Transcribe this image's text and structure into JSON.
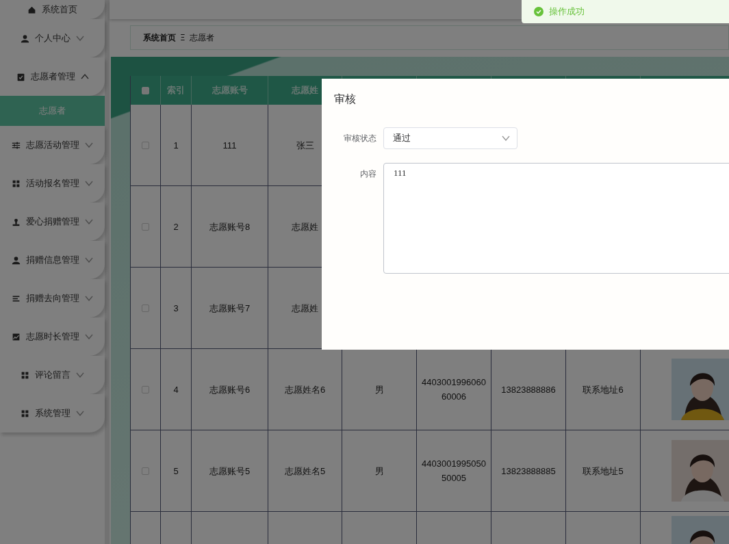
{
  "sidebar": {
    "items": [
      {
        "label": "系统首页"
      },
      {
        "label": "个人中心",
        "expanded": false
      },
      {
        "label": "志愿者管理",
        "expanded": true,
        "children": [
          {
            "label": "志愿者",
            "selected": true
          }
        ]
      },
      {
        "label": "志愿活动管理",
        "expanded": false
      },
      {
        "label": "活动报名管理",
        "expanded": false
      },
      {
        "label": "爱心捐赠管理",
        "expanded": false
      },
      {
        "label": "捐赠信息管理",
        "expanded": false
      },
      {
        "label": "捐赠去向管理",
        "expanded": false
      },
      {
        "label": "志愿时长管理",
        "expanded": false
      },
      {
        "label": "评论留言",
        "expanded": false
      },
      {
        "label": "系统管理",
        "expanded": false
      }
    ]
  },
  "breadcrumb": {
    "home": "系统首页",
    "separator": "Ξ",
    "current": "志愿者"
  },
  "table": {
    "select_all": {
      "checked": false
    },
    "columns": [
      {
        "label": "索引"
      },
      {
        "label": "志愿账号"
      },
      {
        "label": "志愿姓"
      }
    ],
    "rows": [
      {
        "checked": false,
        "cells": [
          "1",
          "111",
          "张三"
        ]
      },
      {
        "checked": false,
        "cells": [
          "2",
          "志愿账号8",
          "志愿姓"
        ]
      },
      {
        "checked": false,
        "cells": [
          "3",
          "志愿账号7",
          "志愿姓"
        ]
      },
      {
        "checked": false,
        "cells": [
          "4",
          "志愿账号6",
          "志愿姓名6",
          "男",
          "440300199606060006",
          "13823888886",
          "联系地址6"
        ],
        "photo": true
      },
      {
        "checked": false,
        "cells": [
          "5",
          "志愿账号5",
          "志愿姓名5",
          "男",
          "440300199505050005",
          "13823888885",
          "联系地址5"
        ],
        "photo": true
      },
      {
        "cells": [],
        "photo": true
      }
    ]
  },
  "dialog": {
    "title": "审核",
    "fields": [
      {
        "kind": "select",
        "label": "审核状态",
        "value": "通过"
      },
      {
        "kind": "textarea",
        "label": "内容",
        "value": "111"
      }
    ]
  },
  "toast": {
    "text": "操作成功"
  }
}
